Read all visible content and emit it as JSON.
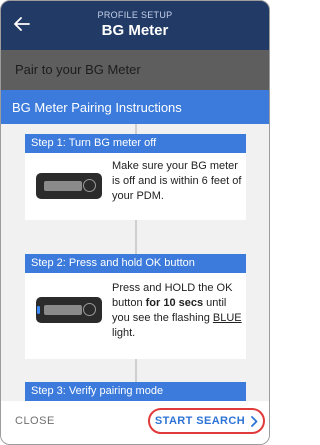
{
  "header": {
    "subtitle": "PROFILE SETUP",
    "title": "BG Meter",
    "back_icon": "back-arrow-icon"
  },
  "background": {
    "section_label": "Pair to your BG Meter"
  },
  "modal": {
    "title": "BG Meter Pairing Instructions",
    "steps": [
      {
        "heading": "Step 1: Turn BG meter off",
        "text": "Make sure your BG meter is off and is within 6 feet of your PDM.",
        "icon": "bg-meter-off-icon"
      },
      {
        "heading": "Step 2: Press and hold OK button",
        "text_before": "Press and HOLD the OK button ",
        "text_bold": "for 10 secs",
        "text_middle": " until you see the flashing ",
        "text_underline": "BLUE",
        "text_after": " light.",
        "icon": "bg-meter-blue-light-icon"
      },
      {
        "heading": "Step 3: Verify pairing mode"
      }
    ],
    "footer": {
      "close_label": "CLOSE",
      "start_label": "START SEARCH",
      "start_icon": "chevron-right-icon"
    }
  },
  "colors": {
    "header_bg": "#213a66",
    "accent_blue": "#3c7bdc",
    "highlight_red": "#e03a3a",
    "led_blue": "#3c8cff"
  }
}
